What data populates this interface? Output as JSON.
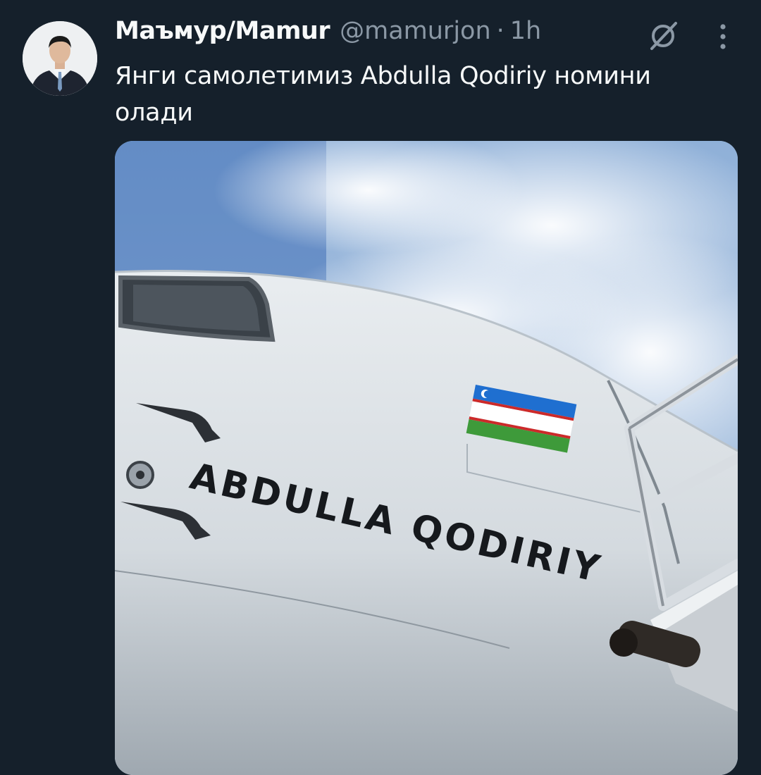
{
  "author": {
    "display_name": "Маъмур/Mamur",
    "handle": "@mamurjon",
    "separator": "·",
    "time": "1h"
  },
  "tweet": {
    "text": "Янги самолетимиз Abdulla Qodiriy номини олади"
  },
  "media": {
    "aircraft_name": "ABDULLA QODIRIY"
  },
  "icons": {
    "grok": "grok-slash-circle-icon",
    "more": "vertical-ellipsis-icon"
  },
  "colors": {
    "background": "#15202b",
    "text_primary": "#f7f9f9",
    "text_secondary": "#8b98a5",
    "flag_blue": "#1f6fd0",
    "flag_green": "#3e9a3a"
  }
}
